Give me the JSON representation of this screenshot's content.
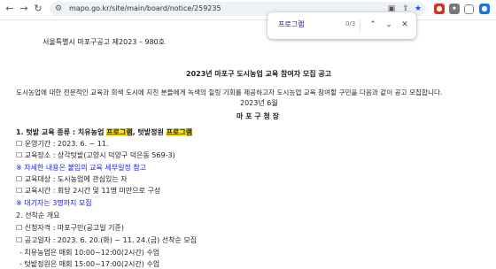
{
  "browser": {
    "url": "mapo.go.kr/site/main/board/notice/259235",
    "find": {
      "query": "프로그램",
      "count": "0/3"
    }
  },
  "doc": {
    "header_line": "서울특별시 마포구공고 제2023 – 980호",
    "title": "2023년 마포구 도시농업 교육 참여자 모집 공고",
    "intro": "도시농업에 대한 전문적인 교육과 회색 도시에 지친 분들에게 녹색의 힐링 기회를 제공하고자 도시농업 교육 참여할 구민을 다음과 같이 공고 모집합니다.",
    "date": "2023년 6월",
    "issuer": "마 포 구 청 장",
    "sec1": {
      "prefix": "1. 텃밭 교육 종류 : 치유농업 ",
      "hl1": "프로그램",
      "mid": ", 텃밭정원 ",
      "hl2": "프로그램"
    },
    "period": "☐ 운영기간 : 2023. 6. ~ 11.",
    "note1": "※ 자세한 내용은 붙임의 교육 세부일정 참고",
    "place": "☐ 교육장소 : 상각텃밭(고양시 덕양구 덕은동 569-3)",
    "target": "☐ 교육대상 : 도시농업에 관심있는 자",
    "time": "☐ 교육시간 : 회당 2시간 및 11명 미만으로 구성",
    "note2": "※ 대기자는 3명까지 모집",
    "sec2": "2. 선착순 개요",
    "qualify": "☐ 신청자격 : 마포구민(공고일 기준)",
    "apply": "☐ 공고일자 : 2023. 6. 20.(화) ~ 11. 24.(금) 선착순 모집",
    "item1": "- 치유농업은 매회 10:00~12:00(2시간) 수업",
    "item2": "- 텃밭정원은 매회 15:00~17:00(2시간) 수업"
  },
  "colors": {
    "highlight": "#ffe600",
    "note": "#1a1ae0"
  }
}
